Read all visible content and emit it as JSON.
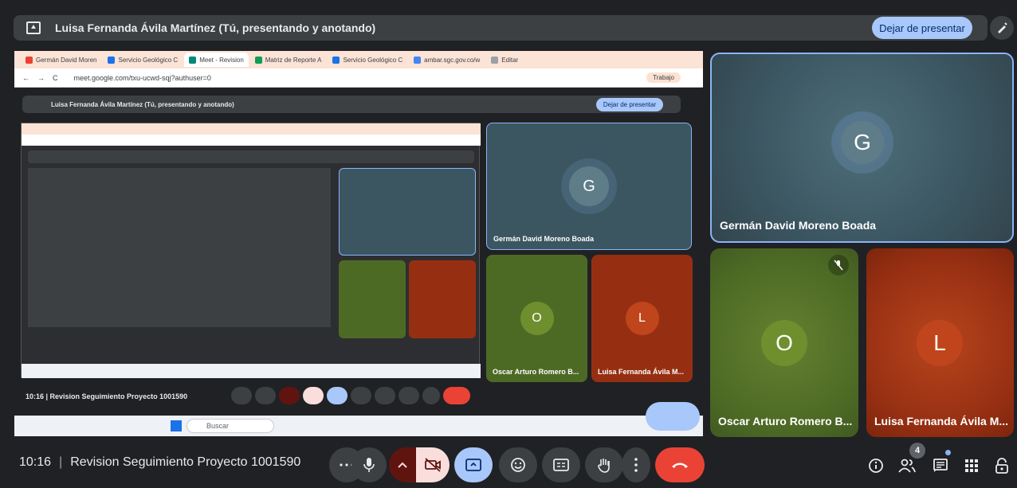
{
  "presenting_bar": {
    "title": "Luisa Fernanda Ávila Martínez (Tú, presentando y anotando)",
    "stop_label": "Dejar de presentar"
  },
  "shared_screen": {
    "tabs": [
      {
        "label": "Germán David Moren",
        "favicon_color": "#ea4335"
      },
      {
        "label": "Servicio Geológico C",
        "favicon_color": "#1a73e8"
      },
      {
        "label": "Meet - Revision",
        "favicon_color": "#00897b",
        "active": true
      },
      {
        "label": "Matriz de Reporte A",
        "favicon_color": "#0f9d58"
      },
      {
        "label": "Servicio Geológico C",
        "favicon_color": "#1a73e8"
      },
      {
        "label": "ambar.sgc.gov.co/w",
        "favicon_color": "#4285f4"
      },
      {
        "label": "Editar",
        "favicon_color": "#9aa0a6"
      }
    ],
    "url": "meet.google.com/txu-ucwd-sqj?authuser=0",
    "profile_label": "Trabajo",
    "inner_title": "Luisa Fernanda Ávila Martínez (Tú, presentando y anotando)",
    "inner_stop": "Dejar de presentar",
    "inner_meeting": "10:16  |  Revision Seguimiento Proyecto 1001590",
    "inner_search": "Buscar",
    "tiles": {
      "german": {
        "name": "Germán David Moreno Boada",
        "initial": "G"
      },
      "oscar": {
        "name": "Oscar Arturo Romero B...",
        "initial": "O"
      },
      "luisa": {
        "name": "Luisa Fernanda Ávila M...",
        "initial": "L"
      }
    }
  },
  "participants": [
    {
      "name": "Germán David Moreno Boada",
      "initial": "G",
      "color": "#3b5661"
    },
    {
      "name": "Oscar Arturo Romero B...",
      "initial": "O",
      "color": "#4d6a25",
      "muted": true
    },
    {
      "name": "Luisa Fernanda Ávila M...",
      "initial": "L",
      "color": "#962f12"
    }
  ],
  "bottom_bar": {
    "time": "10:16",
    "meeting_name": "Revision Seguimiento Proyecto 1001590",
    "people_count": "4"
  },
  "icons": {
    "more": "more-horizontal-icon",
    "mic": "mic-icon",
    "chevron": "chevron-up-icon",
    "camera_off": "camera-off-icon",
    "present": "present-screen-icon",
    "emoji": "emoji-icon",
    "captions": "captions-icon",
    "hand": "raise-hand-icon",
    "options": "more-vertical-icon",
    "hangup": "hangup-icon",
    "info": "info-icon",
    "people": "people-icon",
    "chat": "chat-icon",
    "activities": "apps-grid-icon",
    "host": "host-controls-icon"
  }
}
